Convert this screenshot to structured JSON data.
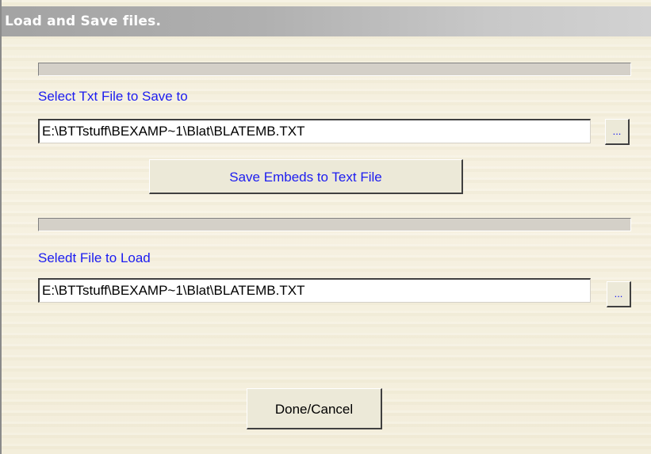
{
  "window": {
    "title": "Load and Save files."
  },
  "save_section": {
    "label": "Select Txt File to Save to",
    "path_value": "E:\\BTTstuff\\BEXAMP~1\\Blat\\BLATEMB.TXT",
    "browse_label": "...",
    "save_button_label": "Save Embeds to Text File"
  },
  "load_section": {
    "label": "Seledt File to Load",
    "path_value": "E:\\BTTstuff\\BEXAMP~1\\Blat\\BLATEMB.TXT",
    "browse_label": "..."
  },
  "footer": {
    "done_button_label": "Done/Cancel"
  },
  "colors": {
    "label_text": "#1c1cf0",
    "background": "#f4efdd",
    "title_bar": "#a3a3a3"
  }
}
